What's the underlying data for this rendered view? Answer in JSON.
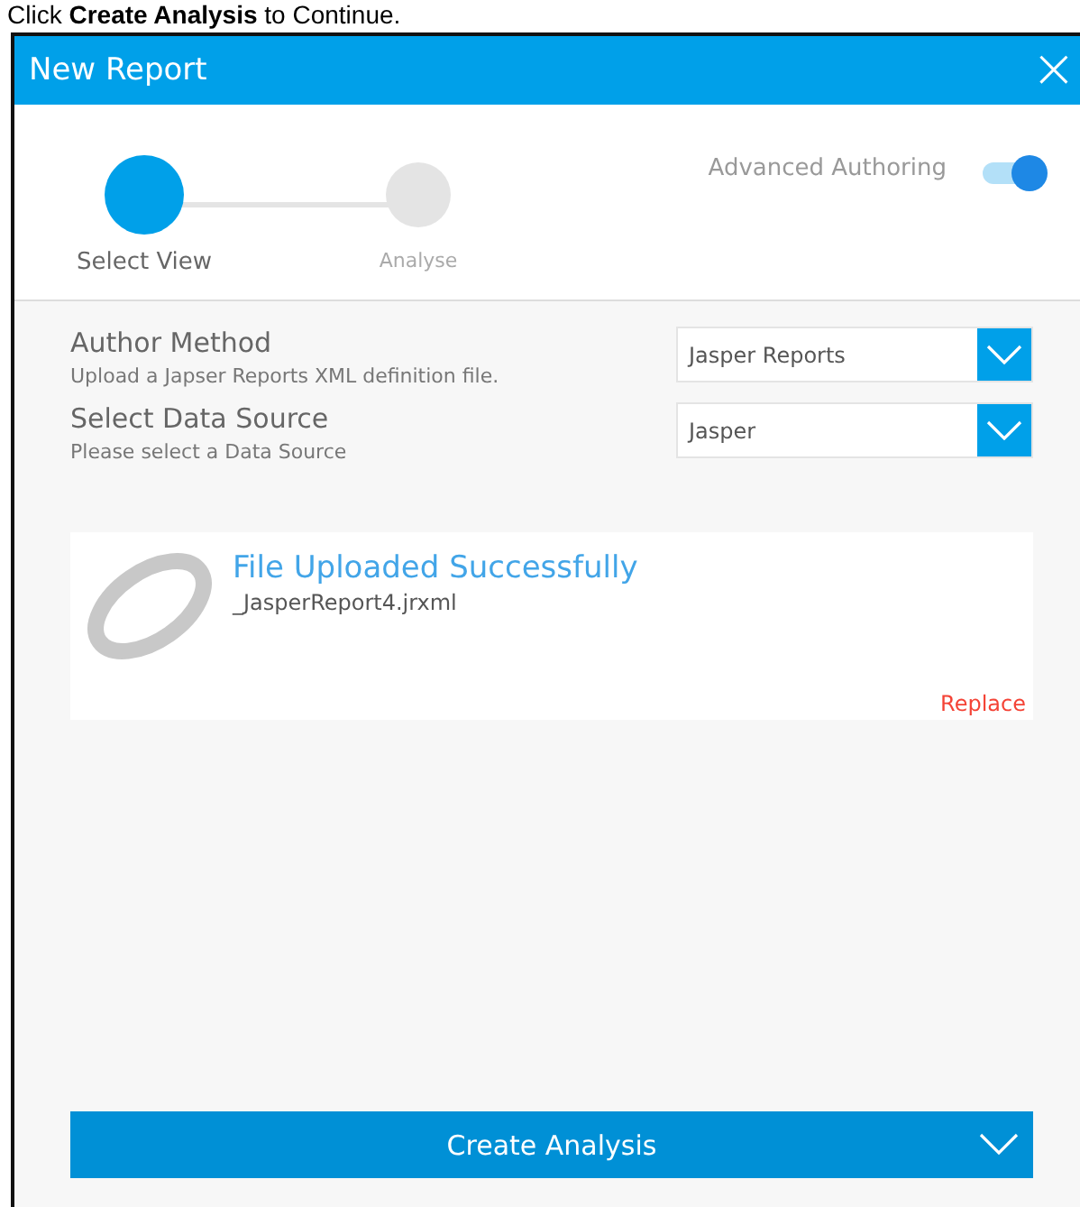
{
  "instruction": "Click **Create Analysis** to Continue.",
  "window": {
    "title": "New Report",
    "close": "×"
  },
  "steps": [
    {
      "label": "Select View",
      "selected": true
    },
    {
      "label": "Analyse",
      "selected": false
    }
  ],
  "advanced_authoring": {
    "label": "Advanced Authoring",
    "on": true
  },
  "fields": [
    {
      "label": "Author Method",
      "hint": "Upload a Japser Reports XML definition file.",
      "value": "Jasper Reports"
    },
    {
      "label": "Select Data Source",
      "hint": "Please select a Data Source",
      "value": "Jasper"
    }
  ],
  "upload": {
    "status": "File Uploaded Successfully",
    "file": "_JasperReport4.jrxml",
    "action": "Replace"
  },
  "primary_button": {
    "label": "Create Analysis"
  }
}
